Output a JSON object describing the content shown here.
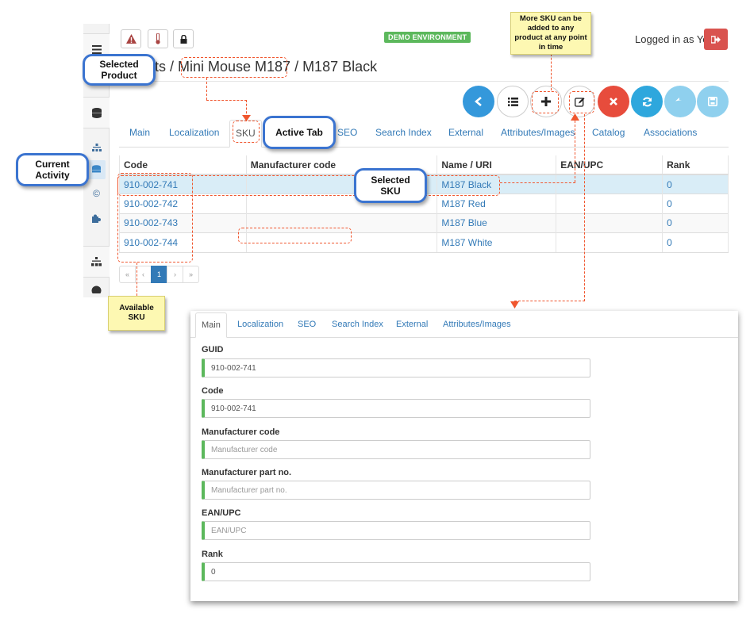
{
  "topbar": {
    "alert_icon": "warning-icon",
    "thermo_icon": "thermometer-icon",
    "lock_icon": "lock-icon",
    "environment": "DEMO ENVIRONMENT",
    "logged_in": "Logged in as Yes",
    "logout_icon": "sign-out-icon"
  },
  "breadcrumb": {
    "text": "cts / Mini Mouse M187 / M187 Black"
  },
  "actions": [
    {
      "name": "back",
      "icon": "chevron-left-icon"
    },
    {
      "name": "list",
      "icon": "list-icon"
    },
    {
      "name": "add",
      "icon": "plus-icon"
    },
    {
      "name": "edit",
      "icon": "edit-icon"
    },
    {
      "name": "delete",
      "icon": "times-icon"
    },
    {
      "name": "refresh",
      "icon": "refresh-icon"
    },
    {
      "name": "undo",
      "icon": "reply-icon"
    },
    {
      "name": "save",
      "icon": "save-icon"
    }
  ],
  "product_tabs": [
    "Main",
    "Localization",
    "SKU",
    "SEO",
    "Search Index",
    "External",
    "Attributes/Images",
    "Catalog",
    "Associations"
  ],
  "sku_table": {
    "headers": [
      "Code",
      "Manufacturer code",
      "Name / URI",
      "EAN/UPC",
      "Rank"
    ],
    "rows": [
      {
        "code": "910-002-741",
        "manufacturer_code": "",
        "name": "M187 Black",
        "ean": "",
        "rank": "0"
      },
      {
        "code": "910-002-742",
        "manufacturer_code": "",
        "name": "M187 Red",
        "ean": "",
        "rank": "0"
      },
      {
        "code": "910-002-743",
        "manufacturer_code": "",
        "name": "M187 Blue",
        "ean": "",
        "rank": "0"
      },
      {
        "code": "910-002-744",
        "manufacturer_code": "",
        "name": "M187 White",
        "ean": "",
        "rank": "0"
      }
    ]
  },
  "pager": {
    "first": "«",
    "prev": "‹",
    "current": "1",
    "next": "›",
    "last": "»"
  },
  "callouts": {
    "selected_product": "Selected Product",
    "active_tab": "Active Tab",
    "current_activity": "Current Activity",
    "selected_sku": "Selected SKU",
    "available_sku": "Available SKU",
    "more_sku": "More SKU can be added to any product at any point in time"
  },
  "detail": {
    "tabs": [
      "Main",
      "Localization",
      "SEO",
      "Search Index",
      "External",
      "Attributes/Images"
    ],
    "fields": [
      {
        "label": "GUID",
        "value": "910-002-741",
        "placeholder": ""
      },
      {
        "label": "Code",
        "value": "910-002-741",
        "placeholder": ""
      },
      {
        "label": "Manufacturer code",
        "value": "",
        "placeholder": "Manufacturer code"
      },
      {
        "label": "Manufacturer part no.",
        "value": "",
        "placeholder": "Manufacturer part no."
      },
      {
        "label": "EAN/UPC",
        "value": "",
        "placeholder": "EAN/UPC"
      },
      {
        "label": "Rank",
        "value": "0",
        "placeholder": ""
      }
    ]
  },
  "colors": {
    "accent": "#337ab7",
    "callout_border": "#3b74d0",
    "annotation_dash": "#f0562e",
    "note_bg": "#fdf8b2",
    "field_marker": "#5cb85c"
  }
}
